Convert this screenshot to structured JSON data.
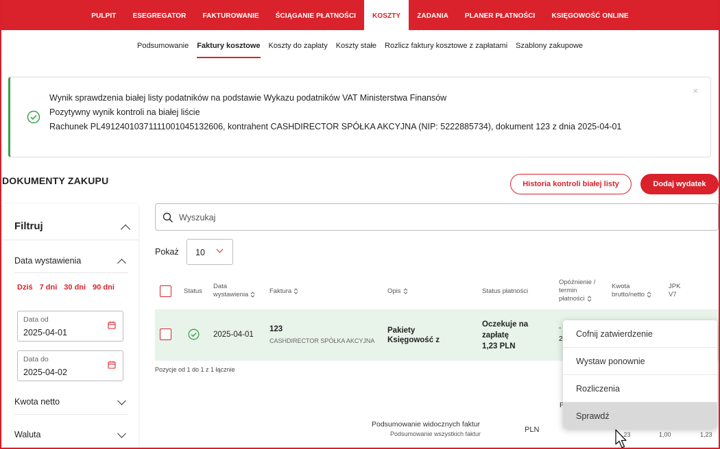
{
  "topnav": {
    "items": [
      "PULPIT",
      "ESEGREGATOR",
      "FAKTUROWANIE",
      "ŚCIĄGANIE PŁATNOŚCI",
      "KOSZTY",
      "ZADANIA",
      "PLANER PŁATNOŚCI",
      "KSIĘGOWOŚĆ ONLINE"
    ],
    "active": "KOSZTY"
  },
  "subnav": {
    "items": [
      "Podsumowanie",
      "Faktury kosztowe",
      "Koszty do zapłaty",
      "Koszty stałe",
      "Rozlicz faktury kosztowe z zapłatami",
      "Szablony zakupowe"
    ],
    "active": "Faktury kosztowe"
  },
  "alert": {
    "line1": "Wynik sprawdzenia białej listy podatników na podstawie Wykazu podatników VAT Ministerstwa Finansów",
    "line2": "Pozytywny wynik kontroli na białej liście",
    "line3": "Rachunek PL49124010371111001045132606, kontrahent CASHDIRECTOR SPÓŁKA AKCYJNA (NIP: 5222885734), dokument 123 z dnia 2025-04-01",
    "close": "×"
  },
  "page": {
    "title": "DOKUMENTY ZAKUPU",
    "history_button": "Historia kontroli białej listy",
    "add_button": "Dodaj wydatek"
  },
  "filters": {
    "title": "Filtruj",
    "date_section": "Data wystawienia",
    "quick": [
      "Dziś",
      "7 dni",
      "30 dni",
      "90 dni"
    ],
    "date_from_label": "Data od",
    "date_from_value": "2025-04-01",
    "date_to_label": "Data do",
    "date_to_value": "2025-04-02",
    "net_section": "Kwota netto",
    "currency_section": "Waluta"
  },
  "search": {
    "placeholder": "Wyszukaj"
  },
  "show": {
    "label": "Pokaż",
    "value": "10"
  },
  "table": {
    "headers": {
      "status": "Status",
      "date_l1": "Data",
      "date_l2": "wystawienia",
      "invoice": "Faktura",
      "desc": "Opis",
      "pay_status": "Status płatności",
      "delay_l1": "Opóźnienie /",
      "delay_l2": "termin",
      "delay_l3": "płatności",
      "amount_l1": "Kwota",
      "amount_l2": "brutto/netto",
      "jpk_l1": "JPK",
      "jpk_l2": "V7"
    },
    "row": {
      "date": "2025-04-01",
      "invoice_no": "123",
      "contractor": "CASHDIRECTOR SPÓŁKA AKCYJNA",
      "desc_l1": "Pakiety",
      "desc_l2": "Księgowość z",
      "pay_l1": "Oczekuje na",
      "pay_l2": "zapłatę",
      "pay_l3": "1,23 PLN",
      "delay_partial": "-",
      "delay_partial2": "2"
    },
    "paging": "Pozycje od 1 do 1 z 1 łącznie"
  },
  "summary": {
    "visible": "Podsumowanie widocznych faktur",
    "all": "Podsumowanie wszystkich faktur",
    "currency": "PLN",
    "gross_partial": ",23",
    "net": "1,00",
    "gross": "1,23",
    "f_partial": "F"
  },
  "context_menu": {
    "items": [
      "Cofnij zatwierdzenie",
      "Wystaw ponownie",
      "Rozliczenia",
      "Sprawdź"
    ],
    "hovered": "Sprawdź"
  },
  "colors": {
    "brand": "#d9222b",
    "success": "#3aa04a",
    "row_highlight": "#e8f3ea"
  }
}
